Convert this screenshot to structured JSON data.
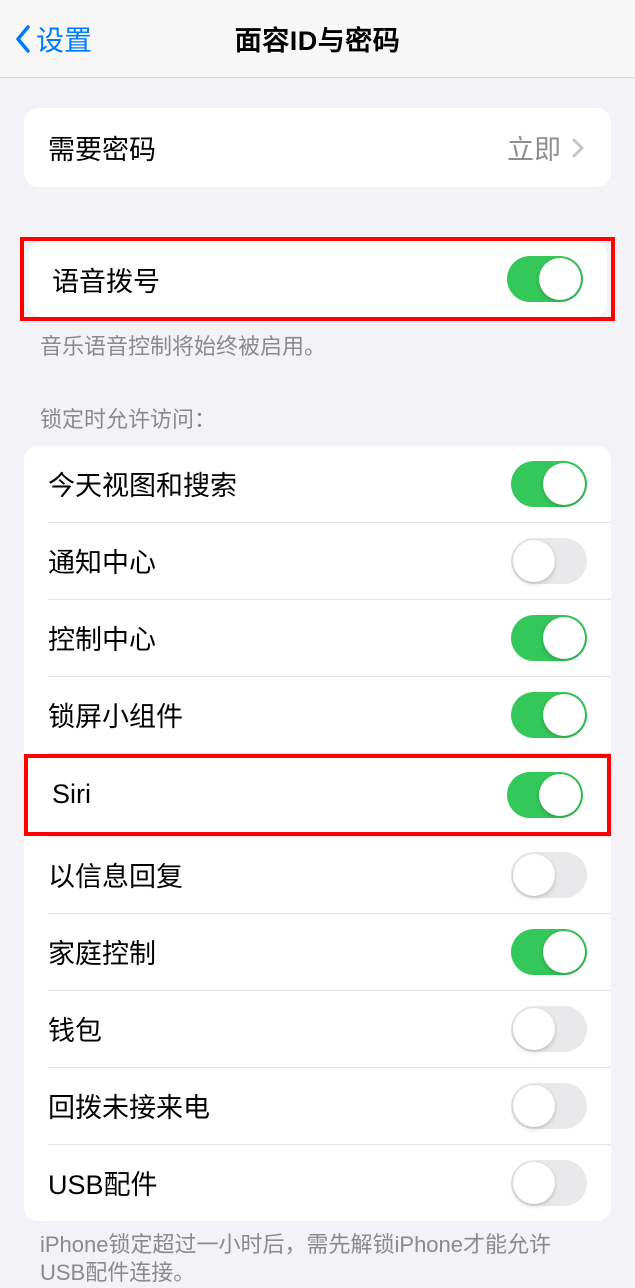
{
  "nav": {
    "back_label": "设置",
    "title": "面容ID与密码"
  },
  "passcode": {
    "label": "需要密码",
    "value": "立即"
  },
  "voiceDial": {
    "label": "语音拨号",
    "on": true,
    "footer": "音乐语音控制将始终被启用。"
  },
  "lockAccess": {
    "header": "锁定时允许访问：",
    "items": [
      {
        "label": "今天视图和搜索",
        "on": true
      },
      {
        "label": "通知中心",
        "on": false
      },
      {
        "label": "控制中心",
        "on": true
      },
      {
        "label": "锁屏小组件",
        "on": true
      },
      {
        "label": "Siri",
        "on": true
      },
      {
        "label": "以信息回复",
        "on": false
      },
      {
        "label": "家庭控制",
        "on": true
      },
      {
        "label": "钱包",
        "on": false
      },
      {
        "label": "回拨未接来电",
        "on": false
      },
      {
        "label": "USB配件",
        "on": false
      }
    ],
    "footer": "iPhone锁定超过一小时后，需先解锁iPhone才能允许USB配件连接。"
  }
}
